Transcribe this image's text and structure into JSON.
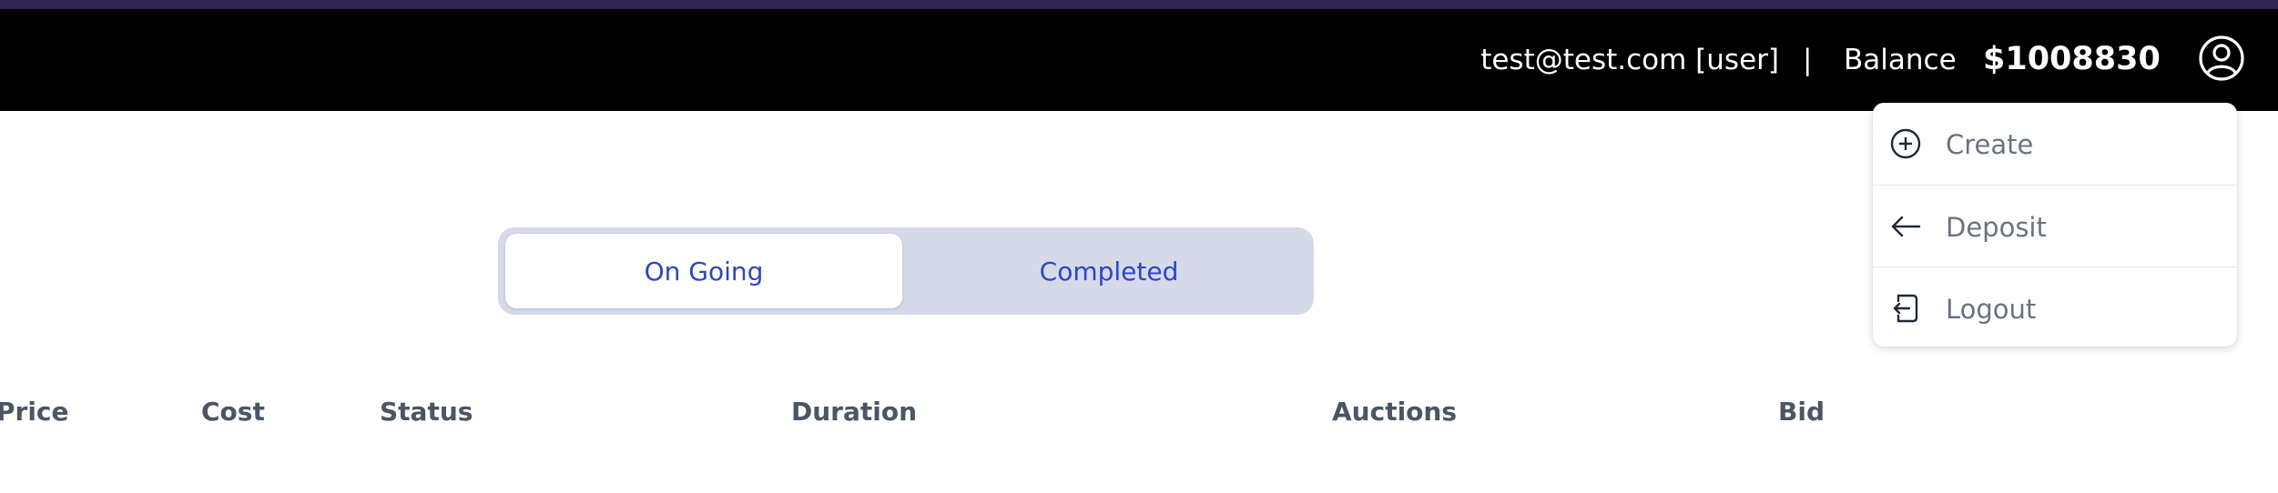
{
  "header": {
    "user": "test@test.com [user]",
    "separator": "|",
    "balance_label": "Balance",
    "balance_value": "$1008830",
    "profile_icon": "user-circle-icon"
  },
  "tabs": {
    "ongoing": "On Going",
    "completed": "Completed"
  },
  "table": {
    "columns": [
      "Price",
      "Cost",
      "Status",
      "Duration",
      "Auctions",
      "Bid"
    ]
  },
  "menu": {
    "items": [
      {
        "label": "Create",
        "icon": "plus-circle-icon"
      },
      {
        "label": "Deposit",
        "icon": "arrow-left-icon"
      },
      {
        "label": "Logout",
        "icon": "logout-icon"
      }
    ]
  },
  "colors": {
    "accent_strip": "#2f2452",
    "topbar": "#000000",
    "toggle_bg": "#d6d9e7",
    "tab_text": "#2b47c8"
  }
}
